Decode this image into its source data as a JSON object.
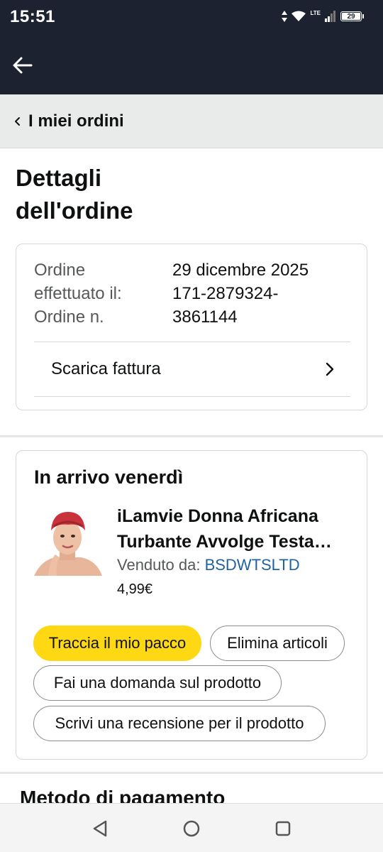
{
  "status_bar": {
    "time": "15:51",
    "network": "LTE",
    "battery": "29",
    "icons": [
      "data-arrows-icon",
      "wifi-icon",
      "signal-icon",
      "battery-icon"
    ]
  },
  "app_bar": {
    "back_icon": "back-arrow-icon"
  },
  "breadcrumb": {
    "label": "I miei ordini",
    "icon": "chevron-left-icon"
  },
  "page": {
    "title_line1": "Dettagli",
    "title_line2": "dell'ordine"
  },
  "order_info": {
    "placed_label_line1": "Ordine",
    "placed_label_line2": "effettuato il:",
    "number_label": "Ordine n.",
    "placed_date": "29 dicembre 2025",
    "number_line1": "171-2879324-",
    "number_line2": "3861144",
    "invoice_label": "Scarica fattura"
  },
  "shipment": {
    "arrival": "In arrivo venerdì",
    "product_title_line1": "iLamvie Donna Africana",
    "product_title_line2": "Turbante Avvolge Testa…",
    "seller_prefix": "Venduto da: ",
    "seller_name": "BSDWTSLTD",
    "price": "4,99€",
    "buttons": {
      "track": "Traccia il mio pacco",
      "delete": "Elimina articoli",
      "question": "Fai una domanda sul prodotto",
      "review": "Scrivi una recensione per il prodotto"
    }
  },
  "payment": {
    "title": "Metodo di pagamento"
  },
  "colors": {
    "header_bg": "#1c2230",
    "primary_button": "#ffd814",
    "link": "#2162a1",
    "turban": "#c9323a"
  }
}
